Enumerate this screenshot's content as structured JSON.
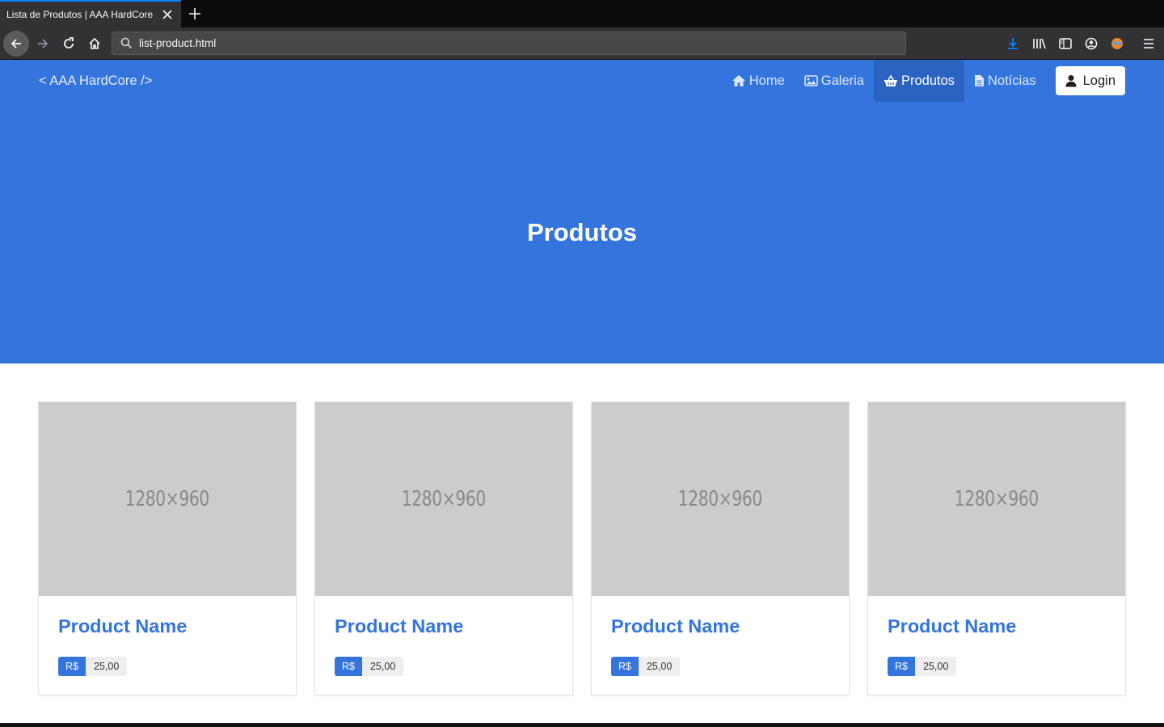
{
  "browser": {
    "tab_title": "Lista de Produtos | AAA HardCore",
    "url": "list-product.html",
    "accent_color": "#0a84ff"
  },
  "site": {
    "brand": "< AAA HardCore />",
    "nav": [
      {
        "label": "Home",
        "icon": "home-icon",
        "active": false
      },
      {
        "label": "Galeria",
        "icon": "image-icon",
        "active": false
      },
      {
        "label": "Produtos",
        "icon": "basket-icon",
        "active": true
      },
      {
        "label": "Notícias",
        "icon": "document-icon",
        "active": false
      }
    ],
    "login_label": "Login",
    "primary_color": "#3474dd"
  },
  "hero": {
    "title": "Produtos"
  },
  "products": [
    {
      "image_label": "1280×960",
      "name": "Product Name",
      "currency": "R$",
      "price": "25,00"
    },
    {
      "image_label": "1280×960",
      "name": "Product Name",
      "currency": "R$",
      "price": "25,00"
    },
    {
      "image_label": "1280×960",
      "name": "Product Name",
      "currency": "R$",
      "price": "25,00"
    },
    {
      "image_label": "1280×960",
      "name": "Product Name",
      "currency": "R$",
      "price": "25,00"
    }
  ]
}
